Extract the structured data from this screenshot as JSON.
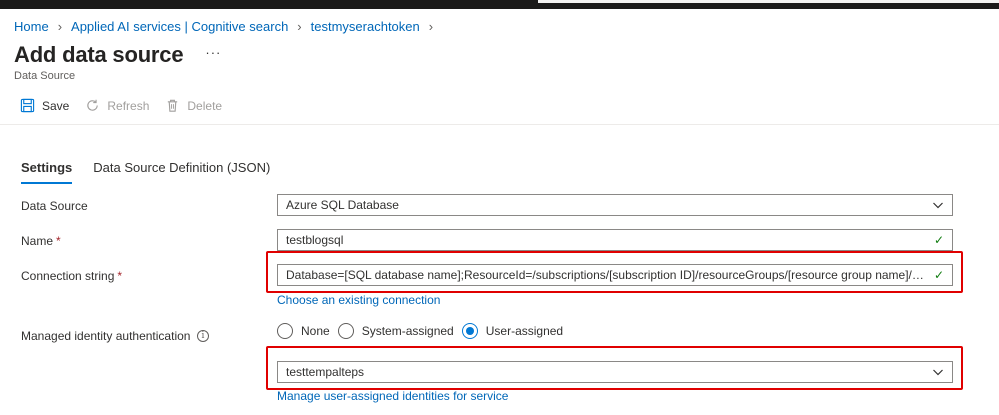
{
  "breadcrumb": {
    "items": [
      "Home",
      "Applied AI services | Cognitive search",
      "testmyserachtoken"
    ]
  },
  "page": {
    "title": "Add data source",
    "subtitle": "Data Source"
  },
  "toolbar": {
    "save_label": "Save",
    "refresh_label": "Refresh",
    "delete_label": "Delete"
  },
  "tabs": [
    {
      "label": "Settings",
      "active": true
    },
    {
      "label": "Data Source Definition (JSON)",
      "active": false
    }
  ],
  "form": {
    "data_source": {
      "label": "Data Source",
      "value": "Azure SQL Database"
    },
    "name": {
      "label": "Name",
      "required_mark": "*",
      "value": "testblogsql"
    },
    "connection_string": {
      "label": "Connection string",
      "required_mark": "*",
      "value": "Database=[SQL database name];ResourceId=/subscriptions/[subscription ID]/resourceGroups/[resource group name]/provid…"
    },
    "choose_connection_link": "Choose an existing connection",
    "managed_identity": {
      "label": "Managed identity authentication",
      "options": [
        "None",
        "System-assigned",
        "User-assigned"
      ],
      "selected": "User-assigned",
      "identity_value": "testtempalteps",
      "manage_link": "Manage user-assigned identities for service"
    }
  },
  "colors": {
    "accent": "#0078d4",
    "link": "#0067b8",
    "highlight": "#e00000",
    "valid": "#107c10",
    "required": "#a4262c"
  }
}
